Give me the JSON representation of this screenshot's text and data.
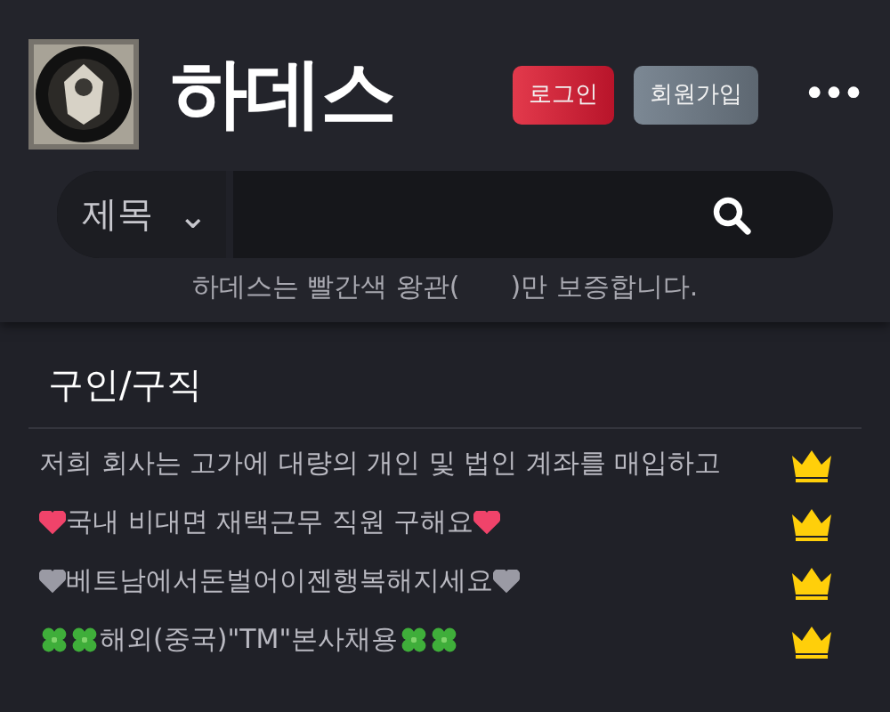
{
  "header": {
    "title": "하데스",
    "buttons": [
      {
        "label": "로그인",
        "kind": "login"
      },
      {
        "label": "회원가입",
        "kind": "signup"
      }
    ],
    "more": "•••"
  },
  "search": {
    "field": "제목",
    "caret": "⌄"
  },
  "notice": "하데스는 빨간색 왕관(      )만 보증합니다.",
  "section": {
    "title": "구인/구직",
    "rows": [
      {
        "crown": true,
        "parts": [
          {
            "kind": "text",
            "text": "저희 회사는 고가에 대량의 개인 및 법인 계좌를 매입하고"
          }
        ]
      },
      {
        "crown": true,
        "parts": [
          {
            "kind": "heart",
            "color": "#f0436a"
          },
          {
            "kind": "text",
            "text": "국내 비대면 재택근무 직원 구해요"
          },
          {
            "kind": "heart",
            "color": "#f0436a"
          }
        ]
      },
      {
        "crown": true,
        "parts": [
          {
            "kind": "heart",
            "color": "#9a9aa4"
          },
          {
            "kind": "text",
            "text": "베트남에서돈벌어이젠행복해지세요"
          },
          {
            "kind": "heart",
            "color": "#9a9aa4"
          }
        ]
      },
      {
        "crown": true,
        "parts": [
          {
            "kind": "clover"
          },
          {
            "kind": "clover"
          },
          {
            "kind": "text",
            "text": "해외(중국)\"TM\"본사채용"
          },
          {
            "kind": "clover"
          },
          {
            "kind": "clover"
          }
        ]
      }
    ]
  }
}
